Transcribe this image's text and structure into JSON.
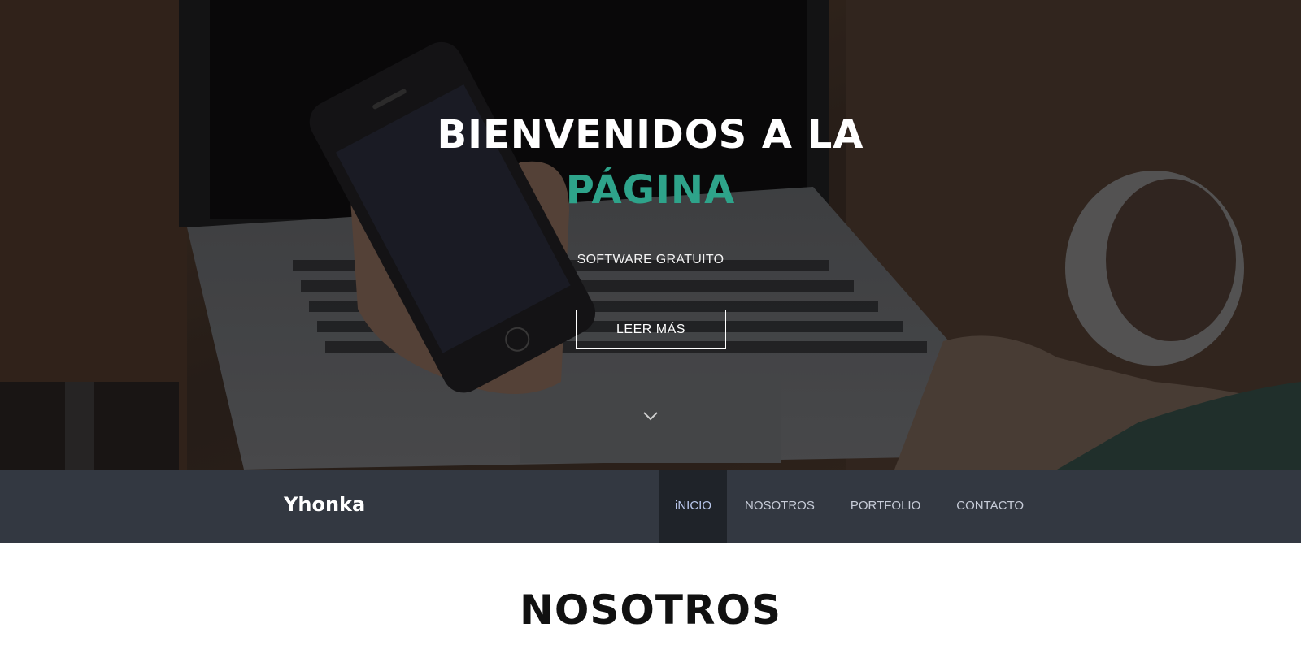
{
  "hero": {
    "title_line1": "BIENVENIDOS A LA",
    "title_line2": "PÁGINA",
    "subtitle": "SOFTWARE GRATUITO",
    "button_label": "LEER MÁS",
    "scroll_icon": "chevron-down-icon",
    "accent_color": "#2ea38a"
  },
  "navbar": {
    "brand": "Yhonka",
    "items": [
      {
        "label": "iNICIO",
        "active": true
      },
      {
        "label": "NOSOTROS",
        "active": false
      },
      {
        "label": "PORTFOLIO",
        "active": false
      },
      {
        "label": "CONTACTO",
        "active": false
      }
    ],
    "background_color": "#333841"
  },
  "section": {
    "title": "NOSOTROS"
  }
}
